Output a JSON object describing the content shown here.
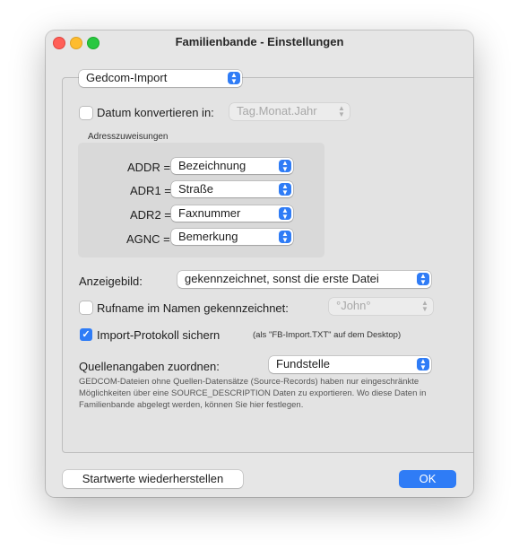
{
  "window": {
    "title": "Familienbande - Einstellungen"
  },
  "section_popup": {
    "value": "Gedcom-Import"
  },
  "date_convert": {
    "label": "Datum konvertieren in:",
    "checked": false,
    "format_value": "Tag.Monat.Jahr"
  },
  "address": {
    "title": "Adresszuweisungen",
    "rows": [
      {
        "key": "ADDR =",
        "value": "Bezeichnung"
      },
      {
        "key": "ADR1 =",
        "value": "Straße"
      },
      {
        "key": "ADR2 =",
        "value": "Faxnummer"
      },
      {
        "key": "AGNC =",
        "value": "Bemerkung"
      }
    ]
  },
  "display_image": {
    "label": "Anzeigebild:",
    "value": "gekennzeichnet, sonst die erste Datei"
  },
  "call_name": {
    "label": "Rufname im Namen gekennzeichnet:",
    "checked": false,
    "value": "°John°"
  },
  "import_log": {
    "label": "Import-Protokoll sichern",
    "checked": true,
    "note": "(als \"FB-Import.TXT\" auf dem Desktop)"
  },
  "sources": {
    "label": "Quellenangaben zuordnen:",
    "value": "Fundstelle",
    "description_lines": [
      "GEDCOM-Dateien ohne Quellen-Datensätze (Source-Records) haben nur eingeschränkte",
      "Möglichkeiten über eine SOURCE_DESCRIPTION Daten zu exportieren. Wo diese Daten in",
      "Familienbande abgelegt werden, können Sie hier festlegen."
    ]
  },
  "buttons": {
    "reset": "Startwerte wiederherstellen",
    "ok": "OK"
  },
  "icons": {
    "checkmark": "✓",
    "popup_arrows": "▲▼"
  },
  "colors": {
    "accent": "#2f7cf6"
  }
}
